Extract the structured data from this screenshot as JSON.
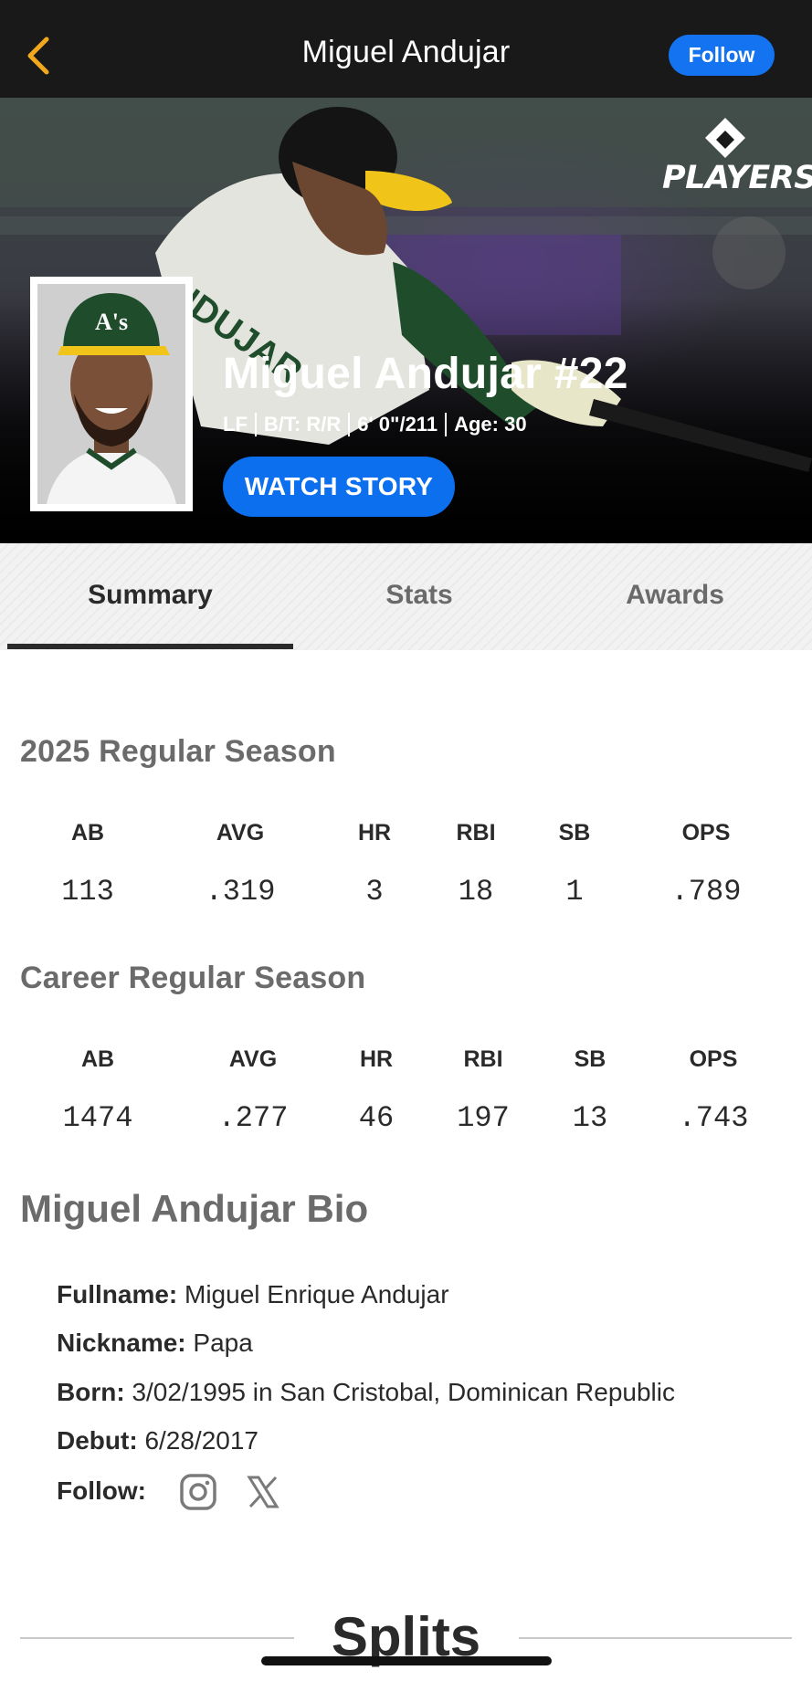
{
  "topbar": {
    "back_icon": "chevron-left-icon",
    "title": "Miguel Andujar",
    "follow_label": "Follow"
  },
  "hero": {
    "brand_logo": "MLB PLAYERS",
    "brand_text": "PLAYERS",
    "player_name": "Miguel Andujar #22",
    "position": "LF",
    "bats_throws": "B/T: R/R",
    "height_weight": "6' 0\"/211",
    "age": "Age: 30",
    "watch_label": "WATCH STORY"
  },
  "tabs": [
    {
      "label": "Summary",
      "active": true
    },
    {
      "label": "Stats",
      "active": false
    },
    {
      "label": "Awards",
      "active": false
    }
  ],
  "season": {
    "title": "2025 Regular Season",
    "headers": [
      "AB",
      "AVG",
      "HR",
      "RBI",
      "SB",
      "OPS"
    ],
    "values": [
      "113",
      ".319",
      "3",
      "18",
      "1",
      ".789"
    ]
  },
  "career": {
    "title": "Career Regular Season",
    "headers": [
      "AB",
      "AVG",
      "HR",
      "RBI",
      "SB",
      "OPS"
    ],
    "values": [
      "1474",
      ".277",
      "46",
      "197",
      "13",
      ".743"
    ]
  },
  "bio": {
    "title": "Miguel Andujar Bio",
    "fullname_label": "Fullname:",
    "fullname": "Miguel Enrique Andujar",
    "nickname_label": "Nickname:",
    "nickname": "Papa",
    "born_label": "Born:",
    "born": "3/02/1995 in San Cristobal, Dominican Republic",
    "debut_label": "Debut:",
    "debut": "6/28/2017",
    "follow_label": "Follow:",
    "social_icons": [
      "instagram-icon",
      "x-icon"
    ]
  },
  "splits": {
    "title": "Splits"
  },
  "colors": {
    "accent_blue": "#1473f0",
    "back_arrow": "#f2a81d",
    "topbar_bg": "#191919"
  }
}
